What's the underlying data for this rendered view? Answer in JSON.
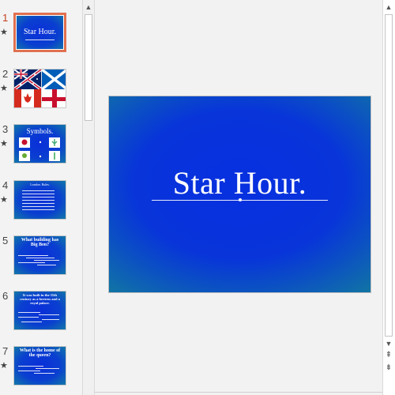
{
  "slides": [
    {
      "number": "1",
      "title": "Star Hour.",
      "has_star": true,
      "selected": true
    },
    {
      "number": "2",
      "title": "",
      "has_star": true,
      "selected": false
    },
    {
      "number": "3",
      "title": "Symbols.",
      "has_star": true,
      "selected": false
    },
    {
      "number": "4",
      "title": "",
      "has_star": true,
      "selected": false
    },
    {
      "number": "5",
      "title": "What building has Big Ben?",
      "has_star": false,
      "selected": false
    },
    {
      "number": "6",
      "title": "It was built in the 11th century as a fortress and a royal palace.",
      "has_star": false,
      "selected": false
    },
    {
      "number": "7",
      "title": "What is the home of the queen?",
      "has_star": true,
      "selected": false
    }
  ],
  "thumb_small": {
    "s4_title": "London. Rules."
  },
  "main_slide": {
    "title": "Star Hour."
  },
  "icons": {
    "star": "★",
    "up_arrow": "▲",
    "down_arrow": "▼",
    "prev_slide": "⇞",
    "next_slide": "⇟"
  },
  "colors": {
    "selected_border": "#e0704f",
    "slide_blue": "#0730e0",
    "slide_teal": "#127a9f"
  }
}
